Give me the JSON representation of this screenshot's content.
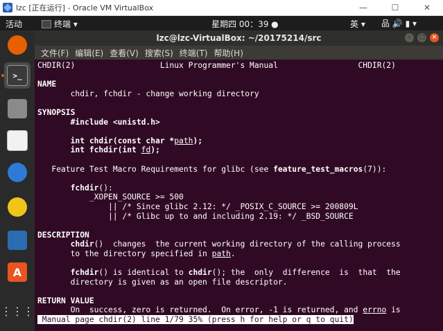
{
  "host_window": {
    "title": "lzc [正在运行] - Oracle VM VirtualBox",
    "minimize": "—",
    "maximize": "☐",
    "close": "✕"
  },
  "topbar": {
    "activities": "活动",
    "app_menu": "终端 ▾",
    "clock": "星期四 00：39 ●",
    "input_method": "英 ▾",
    "system_icons": "品 🔊 ▮ ▾"
  },
  "terminal": {
    "title": "lzc@lzc-VirtualBox: ~/20175214/src",
    "menu": [
      "文件(F)",
      "编辑(E)",
      "查看(V)",
      "搜索(S)",
      "终端(T)",
      "帮助(H)"
    ],
    "lines": [
      [
        {
          "t": "CHDIR(2)                  Linux Programmer's Manual                 CHDIR(2)"
        }
      ],
      [
        {
          "t": ""
        }
      ],
      [
        {
          "t": "NAME",
          "b": true
        }
      ],
      [
        {
          "t": "       chdir, fchdir - change working directory"
        }
      ],
      [
        {
          "t": ""
        }
      ],
      [
        {
          "t": "SYNOPSIS",
          "b": true
        }
      ],
      [
        {
          "t": "       #include <unistd.h>",
          "b": true
        }
      ],
      [
        {
          "t": ""
        }
      ],
      [
        {
          "t": "       int chdir(const char *",
          "b": true
        },
        {
          "t": "path",
          "u": true
        },
        {
          "t": ");",
          "b": true
        }
      ],
      [
        {
          "t": "       int fchdir(int ",
          "b": true
        },
        {
          "t": "fd",
          "u": true
        },
        {
          "t": ");",
          "b": true
        }
      ],
      [
        {
          "t": ""
        }
      ],
      [
        {
          "t": "   Feature Test Macro Requirements for glibc (see "
        },
        {
          "t": "feature_test_macros",
          "b": true
        },
        {
          "t": "(7)):"
        }
      ],
      [
        {
          "t": ""
        }
      ],
      [
        {
          "t": "       "
        },
        {
          "t": "fchdir",
          "b": true
        },
        {
          "t": "():"
        }
      ],
      [
        {
          "t": "           _XOPEN_SOURCE >= 500"
        }
      ],
      [
        {
          "t": "               || /* Since glibc 2.12: */ _POSIX_C_SOURCE >= 200809L"
        }
      ],
      [
        {
          "t": "               || /* Glibc up to and including 2.19: */ _BSD_SOURCE"
        }
      ],
      [
        {
          "t": ""
        }
      ],
      [
        {
          "t": "DESCRIPTION",
          "b": true
        }
      ],
      [
        {
          "t": "       "
        },
        {
          "t": "chdir",
          "b": true
        },
        {
          "t": "()  changes  the current working directory of the calling process"
        }
      ],
      [
        {
          "t": "       to the directory specified in "
        },
        {
          "t": "path",
          "u": true
        },
        {
          "t": "."
        }
      ],
      [
        {
          "t": ""
        }
      ],
      [
        {
          "t": "       "
        },
        {
          "t": "fchdir",
          "b": true
        },
        {
          "t": "() is identical to "
        },
        {
          "t": "chdir",
          "b": true
        },
        {
          "t": "(); the  only  difference  is  that  the"
        }
      ],
      [
        {
          "t": "       directory is given as an open file descriptor."
        }
      ],
      [
        {
          "t": ""
        }
      ],
      [
        {
          "t": "RETURN VALUE",
          "b": true
        }
      ],
      [
        {
          "t": "       On  success, zero is returned.  On error, -1 is returned, and "
        },
        {
          "t": "errno",
          "u": true
        },
        {
          "t": " is"
        }
      ],
      [
        {
          "t": " Manual page chdir(2) line 1/79 35% (press h for help or q to quit)",
          "s": true
        }
      ]
    ]
  },
  "dock": {
    "items": [
      {
        "name": "firefox-icon",
        "color": "#e66000"
      },
      {
        "name": "terminal-icon",
        "color": "#3a3a3a",
        "active": true
      },
      {
        "name": "files-icon",
        "color": "#8a8a8a"
      },
      {
        "name": "text-editor-icon",
        "color": "#f2f2f2"
      },
      {
        "name": "thunderbird-icon",
        "color": "#2d7bd6"
      },
      {
        "name": "rhythmbox-icon",
        "color": "#f0c419"
      },
      {
        "name": "libreoffice-writer-icon",
        "color": "#2b6cb0"
      },
      {
        "name": "software-center-icon",
        "color": "#e95420"
      },
      {
        "name": "show-apps-icon",
        "color": "#dddddd"
      }
    ]
  }
}
